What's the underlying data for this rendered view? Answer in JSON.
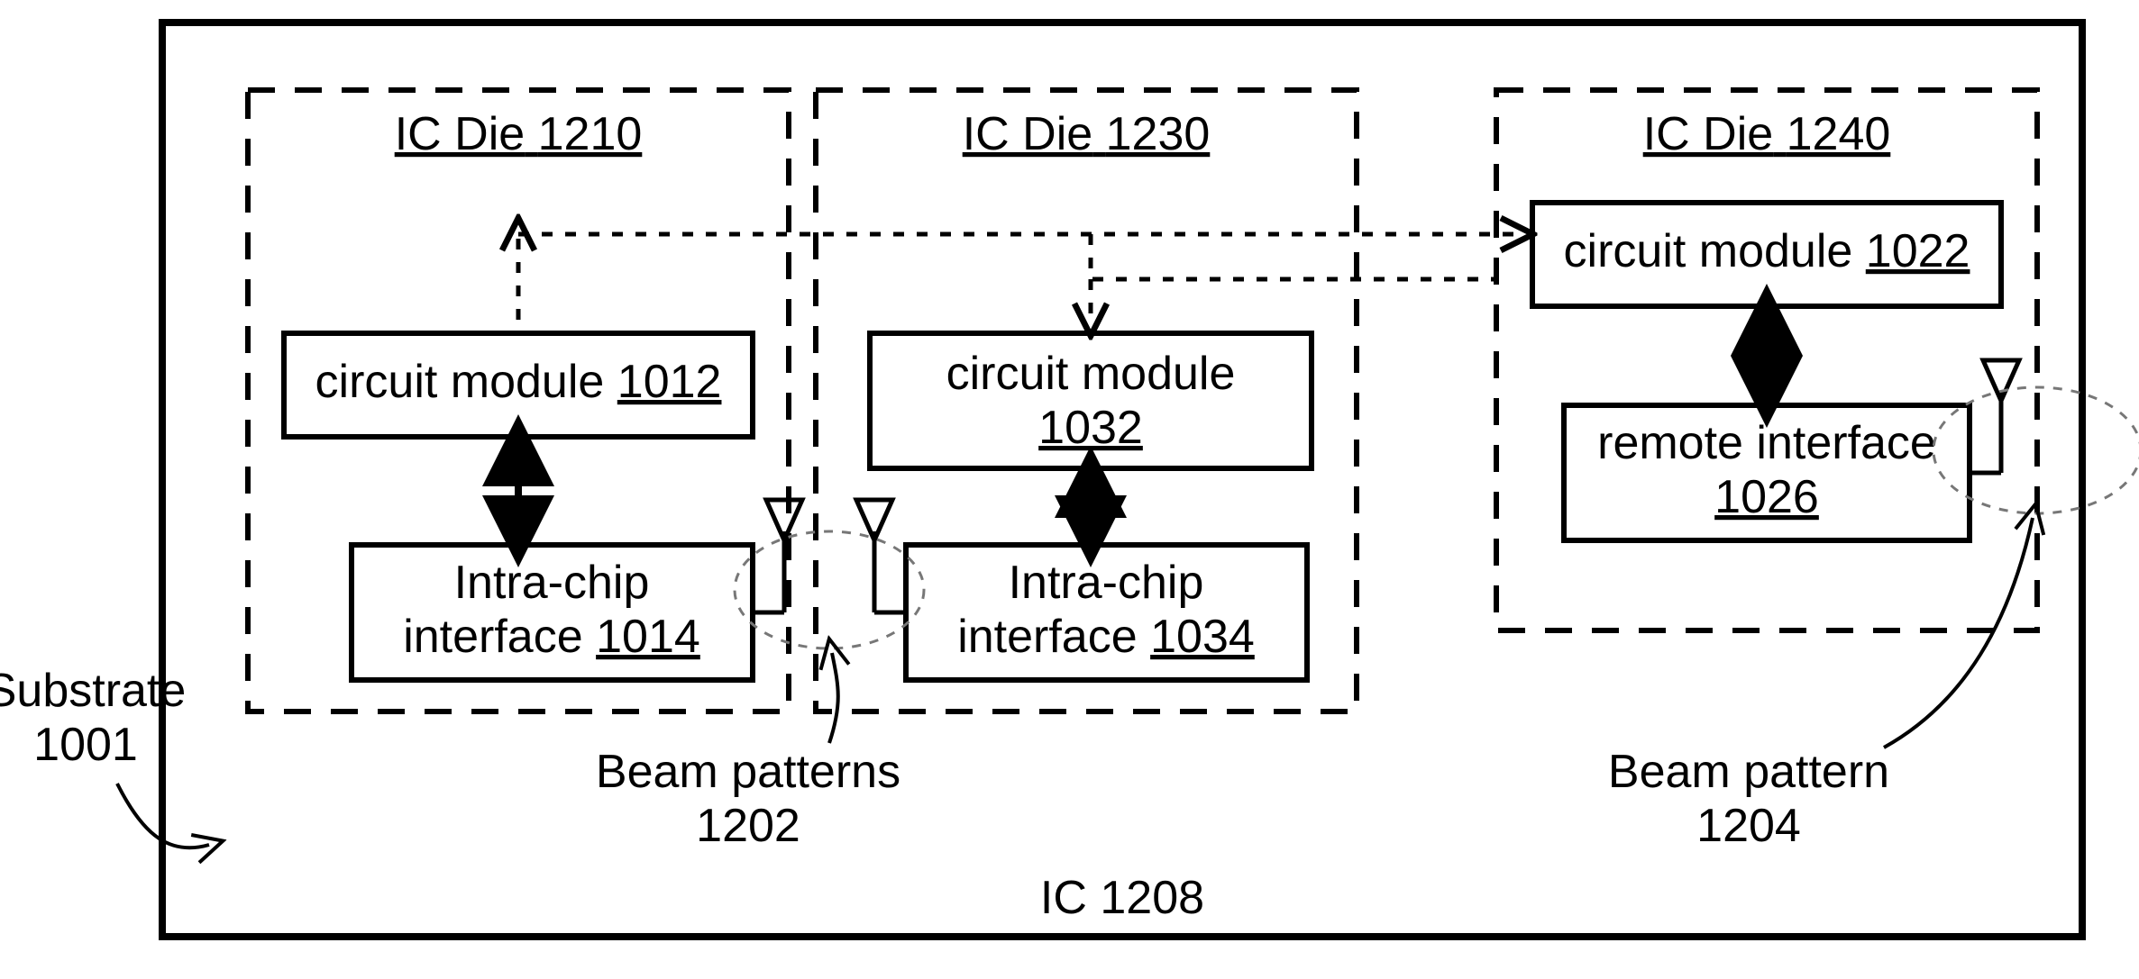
{
  "ic": {
    "label": "IC",
    "number": "1208"
  },
  "substrate": {
    "label": "Substrate",
    "number": "1001"
  },
  "die1": {
    "title_prefix": "IC Die",
    "title_num": "1210",
    "circuit_label": "circuit module",
    "circuit_num": "1012",
    "interface_line1": "Intra-chip",
    "interface_line2_label": "interface",
    "interface_num": "1014"
  },
  "die2": {
    "title_prefix": "IC Die",
    "title_num": "1230",
    "circuit_label": "circuit module",
    "circuit_num": "1032",
    "interface_line1": "Intra-chip",
    "interface_line2_label": "interface",
    "interface_num": "1034"
  },
  "die3": {
    "title_prefix": "IC Die",
    "title_num": "1240",
    "circuit_label": "circuit module",
    "circuit_num": "1022",
    "interface_label": "remote interface",
    "interface_num": "1026"
  },
  "beam1": {
    "label": "Beam patterns",
    "number": "1202"
  },
  "beam2": {
    "label": "Beam pattern",
    "number": "1204"
  }
}
